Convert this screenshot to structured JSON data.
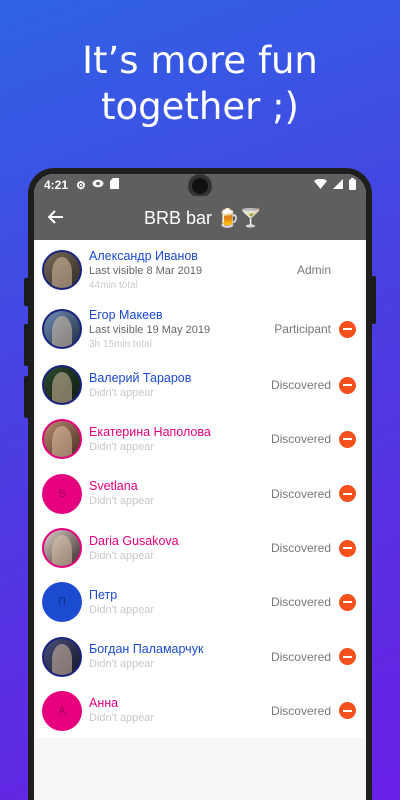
{
  "headline": {
    "line1": "It’s more fun",
    "line2": "together ;)"
  },
  "status": {
    "time": "4:21",
    "icons": [
      "gear-icon",
      "eye-icon",
      "sd-card-icon",
      "wifi-icon",
      "signal-icon",
      "battery-icon"
    ]
  },
  "appbar": {
    "title": "BRB bar 🍺🍸",
    "back_icon": "arrow-left-icon"
  },
  "members": [
    {
      "name": "Александр Иванов",
      "color": "#1a4bd0",
      "line2": "Last visible 8 Mar 2019",
      "line3": "44min total",
      "role": "Admin",
      "removable": false
    },
    {
      "name": "Егор Макеев",
      "color": "#1a4bd0",
      "line2": "Last visible 19 May 2019",
      "line3": "3h 15min total",
      "role": "Participant",
      "removable": true
    },
    {
      "name": "Валерий Тараров",
      "color": "#1a4bd0",
      "line2": "Didn't appear",
      "role": "Discovered",
      "removable": true
    },
    {
      "name": "Екатерина Наполова",
      "color": "#e6007e",
      "line2": "Didn't appear",
      "role": "Discovered",
      "removable": true
    },
    {
      "name": "Svetlana",
      "color": "#e6007e",
      "line2": "Didn't appear",
      "role": "Discovered",
      "removable": true,
      "avatar_letter": "S"
    },
    {
      "name": "Daria Gusakova",
      "color": "#e6007e",
      "line2": "Didn't appear",
      "role": "Discovered",
      "removable": true
    },
    {
      "name": "Петр",
      "color": "#1a4bd0",
      "line2": "Didn't appear",
      "role": "Discovered",
      "removable": true,
      "avatar_letter": "П"
    },
    {
      "name": "Богдан Паламарчук",
      "color": "#1a4bd0",
      "line2": "Didn't appear",
      "role": "Discovered",
      "removable": true
    },
    {
      "name": "Анна",
      "color": "#e6007e",
      "line2": "Didn't appear",
      "role": "Discovered",
      "removable": true,
      "avatar_letter": "А"
    }
  ],
  "colors": {
    "background_start": "#2f63e6",
    "background_end": "#6a1fe6",
    "appbar": "#5f5f5f",
    "remove": "#f4511e",
    "male": "#1a4bd0",
    "female": "#e6007e"
  }
}
